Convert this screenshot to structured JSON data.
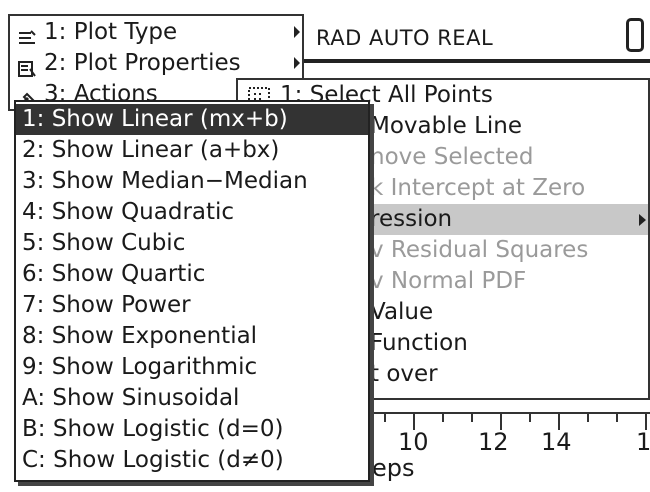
{
  "status": {
    "text": "RAD AUTO REAL"
  },
  "menu_level1": {
    "items": [
      {
        "label": "1: Plot Type",
        "icon": "plot-type-icon"
      },
      {
        "label": "2: Plot Properties",
        "icon": "plot-properties-icon"
      },
      {
        "label": "3: Actions",
        "icon": "actions-icon"
      }
    ]
  },
  "menu_level2": {
    "items": [
      {
        "label": "1: Select All Points",
        "icon": "select-all-icon",
        "enabled": true
      },
      {
        "label": " Movable Line",
        "enabled": true
      },
      {
        "label": "nove Selected",
        "enabled": false
      },
      {
        "label": "k Intercept at Zero",
        "enabled": false
      },
      {
        "label": "ression",
        "enabled": true
      },
      {
        "label": "v Residual Squares",
        "enabled": false
      },
      {
        "label": "v Normal PDF",
        "enabled": false
      },
      {
        "label": " Value",
        "enabled": true
      },
      {
        "label": " Function",
        "enabled": true
      },
      {
        "label": "t over",
        "enabled": true
      }
    ]
  },
  "menu_level3": {
    "items": [
      "1: Show Linear (mx+b)",
      "2: Show Linear (a+bx)",
      "3: Show Median−Median",
      "4: Show Quadratic",
      "5: Show Cubic",
      "6: Show Quartic",
      "7: Show Power",
      "8: Show Exponential",
      "9: Show Logarithmic",
      "A: Show Sinusoidal",
      "B: Show Logistic (d=0)",
      "C: Show Logistic (d≠0)"
    ],
    "selected_index": 0
  },
  "axis": {
    "tick_labels": [
      "10",
      "12",
      "14",
      "1"
    ],
    "title": "eps"
  },
  "colors": {
    "selected_bg": "#333333",
    "active_bg": "#c8c8c8",
    "disabled_text": "#9a9a9a"
  }
}
